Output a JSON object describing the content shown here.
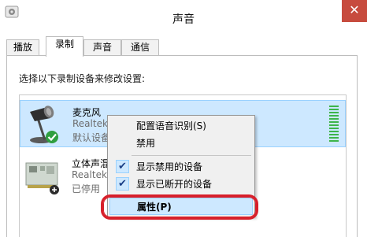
{
  "window": {
    "title": "声音",
    "close_glyph": "✕"
  },
  "tabs": [
    {
      "label": "播放",
      "active": false
    },
    {
      "label": "录制",
      "active": true
    },
    {
      "label": "声音",
      "active": false
    },
    {
      "label": "通信",
      "active": false
    }
  ],
  "instruction": "选择以下录制设备来修改设置:",
  "devices": [
    {
      "name": "麦克风",
      "driver": "Realtek",
      "status": "默认设备",
      "icon": "microphone-icon",
      "selected": true,
      "default_badge": "green-check"
    },
    {
      "name": "立体声混",
      "driver": "Realtek",
      "status": "已停用",
      "icon": "sound-card-icon",
      "selected": false
    }
  ],
  "context_menu": {
    "items": [
      {
        "label": "配置语音识别(S)",
        "checked": false
      },
      {
        "label": "禁用",
        "checked": false
      },
      {
        "label": "显示禁用的设备",
        "checked": true
      },
      {
        "label": "显示已断开的设备",
        "checked": true
      },
      {
        "label": "属性(P)",
        "checked": false,
        "highlighted": true
      }
    ],
    "check_glyph": "✔"
  },
  "colors": {
    "selection": "#cde8ff",
    "close_button": "#c74b3e",
    "level_meter": "#3db54a",
    "annotation_ring": "#d71f2a"
  }
}
